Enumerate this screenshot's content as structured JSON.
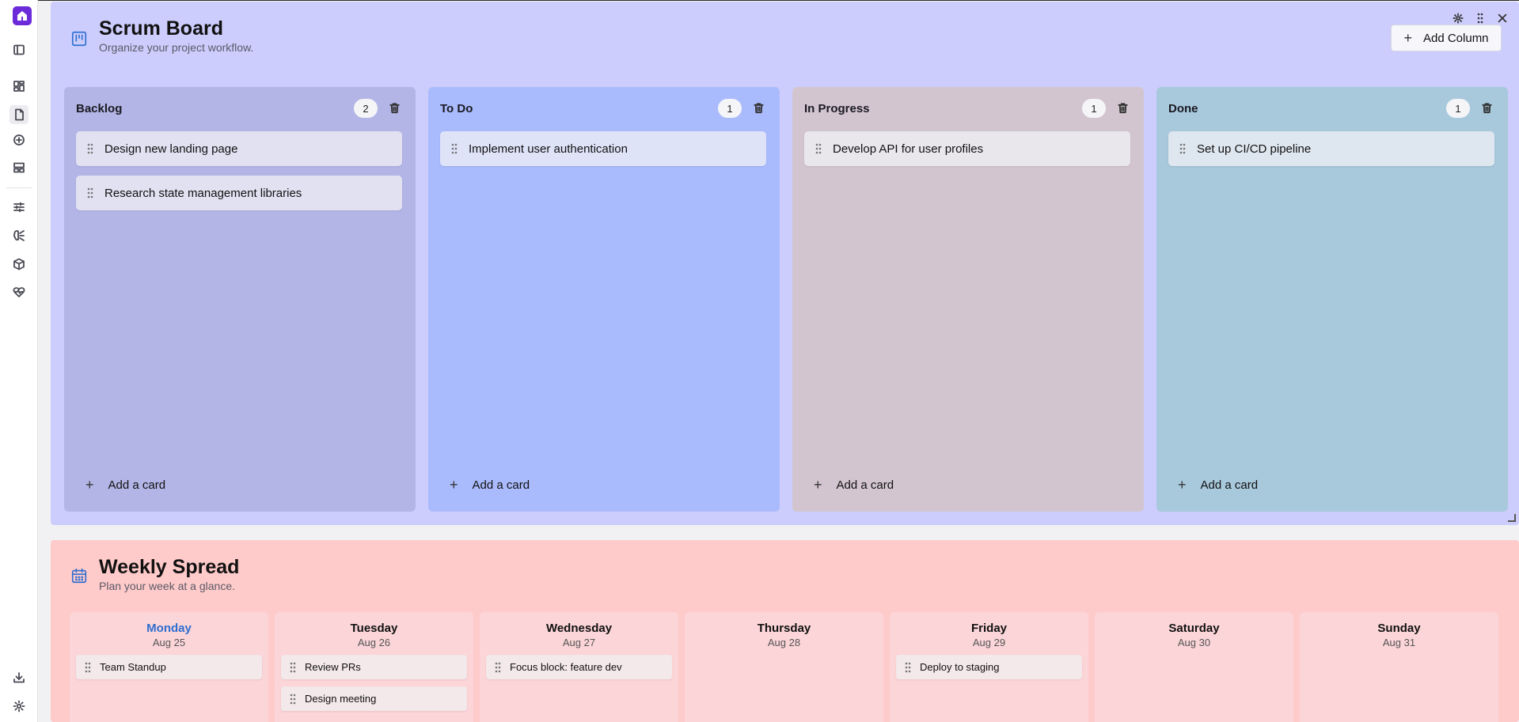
{
  "colors": {
    "accent": "#6c2bd9",
    "scrum_bg": "#cccdfd",
    "weekly_bg": "#ffcaca",
    "backlog": "#b3b5e6",
    "todo": "#aabbfd",
    "in_progress": "#d3c5cf",
    "done": "#a8c8dc",
    "title_icon": "#2f6fd0"
  },
  "sidebar": {
    "icons": [
      "logo-icon",
      "sidebar-toggle-icon",
      "dashboard-icon",
      "document-icon",
      "add-circle-icon",
      "layout-icon",
      "sliders-icon",
      "brain-icon",
      "package-icon",
      "heart-pulse-icon",
      "download-icon",
      "settings-icon"
    ]
  },
  "scrum": {
    "title": "Scrum Board",
    "subtitle": "Organize your project workflow.",
    "add_column_label": "Add Column",
    "add_card_label": "Add a card",
    "columns": [
      {
        "title": "Backlog",
        "count": "2",
        "cards": [
          "Design new landing page",
          "Research state management libraries"
        ]
      },
      {
        "title": "To Do",
        "count": "1",
        "cards": [
          "Implement user authentication"
        ]
      },
      {
        "title": "In Progress",
        "count": "1",
        "cards": [
          "Develop API for user profiles"
        ]
      },
      {
        "title": "Done",
        "count": "1",
        "cards": [
          "Set up CI/CD pipeline"
        ]
      }
    ]
  },
  "weekly": {
    "title": "Weekly Spread",
    "subtitle": "Plan your week at a glance.",
    "days": [
      {
        "name": "Monday",
        "date": "Aug 25",
        "events": [
          "Team Standup"
        ]
      },
      {
        "name": "Tuesday",
        "date": "Aug 26",
        "events": [
          "Review PRs",
          "Design meeting"
        ]
      },
      {
        "name": "Wednesday",
        "date": "Aug 27",
        "events": [
          "Focus block: feature dev"
        ]
      },
      {
        "name": "Thursday",
        "date": "Aug 28",
        "events": []
      },
      {
        "name": "Friday",
        "date": "Aug 29",
        "events": [
          "Deploy to staging"
        ]
      },
      {
        "name": "Saturday",
        "date": "Aug 30",
        "events": []
      },
      {
        "name": "Sunday",
        "date": "Aug 31",
        "events": []
      }
    ]
  }
}
